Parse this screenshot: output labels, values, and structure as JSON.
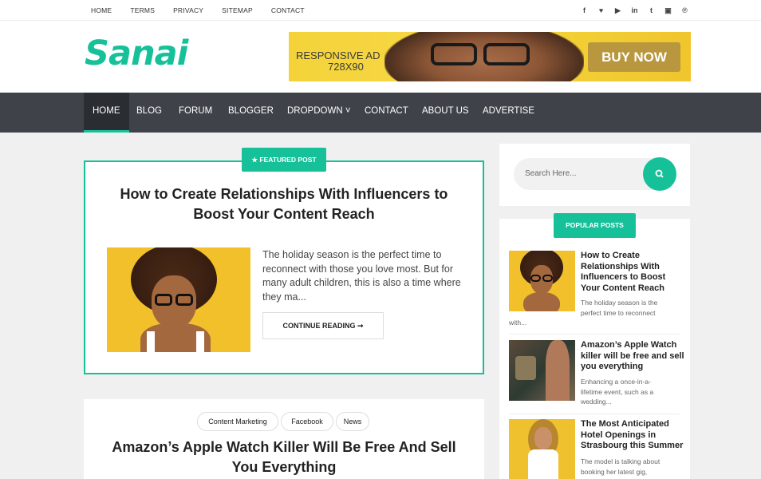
{
  "topbar": {
    "links": [
      "HOME",
      "TERMS",
      "PRIVACY",
      "SITEMAP",
      "CONTACT"
    ],
    "social_icons": [
      "facebook-icon",
      "twitter-icon",
      "youtube-icon",
      "linkedin-icon",
      "tumblr-icon",
      "instagram-icon",
      "pinterest-icon"
    ],
    "social_glyphs": [
      "f",
      "♥",
      "▶",
      "in",
      "t",
      "▣",
      "℗"
    ]
  },
  "logo": {
    "text": "Sanai"
  },
  "ad": {
    "line1": "RESPONSIVE AD",
    "line2": "728X90",
    "button": "BUY NOW"
  },
  "nav": {
    "items": [
      "HOME",
      "BLOG",
      "FORUM",
      "BLOGGER",
      "DROPDOWN ˅",
      "CONTACT",
      "ABOUT US",
      "ADVERTISE"
    ],
    "active": "HOME"
  },
  "featured": {
    "badge": "★ FEATURED POST",
    "title": "How to Create Relationships With Influencers to Boost Your Content Reach",
    "excerpt": "The holiday season is the perfect time to reconnect with those you love most. But for many adult children, this is also a time where they ma...",
    "read_more": "CONTINUE READING ➞"
  },
  "second_post": {
    "tags": [
      "Content Marketing",
      "Facebook",
      "News"
    ],
    "title": "Amazon’s Apple Watch Killer Will Be Free And Sell You Everything"
  },
  "sidebar": {
    "search_placeholder": "Search Here...",
    "popular_label": "POPULAR POSTS",
    "popular": [
      {
        "title": "How to Create Relationships With Influencers to Boost Your Content Reach",
        "excerpt_side": "The holiday season is the perfect time to reconnect",
        "excerpt_below": "with..."
      },
      {
        "title": "Amazon’s Apple Watch killer will be free and sell you everything",
        "excerpt_side": "Enhancing a once-in-a-lifetime event, such as a wedding..."
      },
      {
        "title": "The Most Anticipated Hotel Openings in Strasbourg this Summer",
        "excerpt_side": "The model is talking about booking her latest gig,"
      }
    ]
  },
  "colors": {
    "accent": "#16c19a",
    "nav_bg": "#3f4349",
    "ad_bg": "#f4d33a"
  }
}
